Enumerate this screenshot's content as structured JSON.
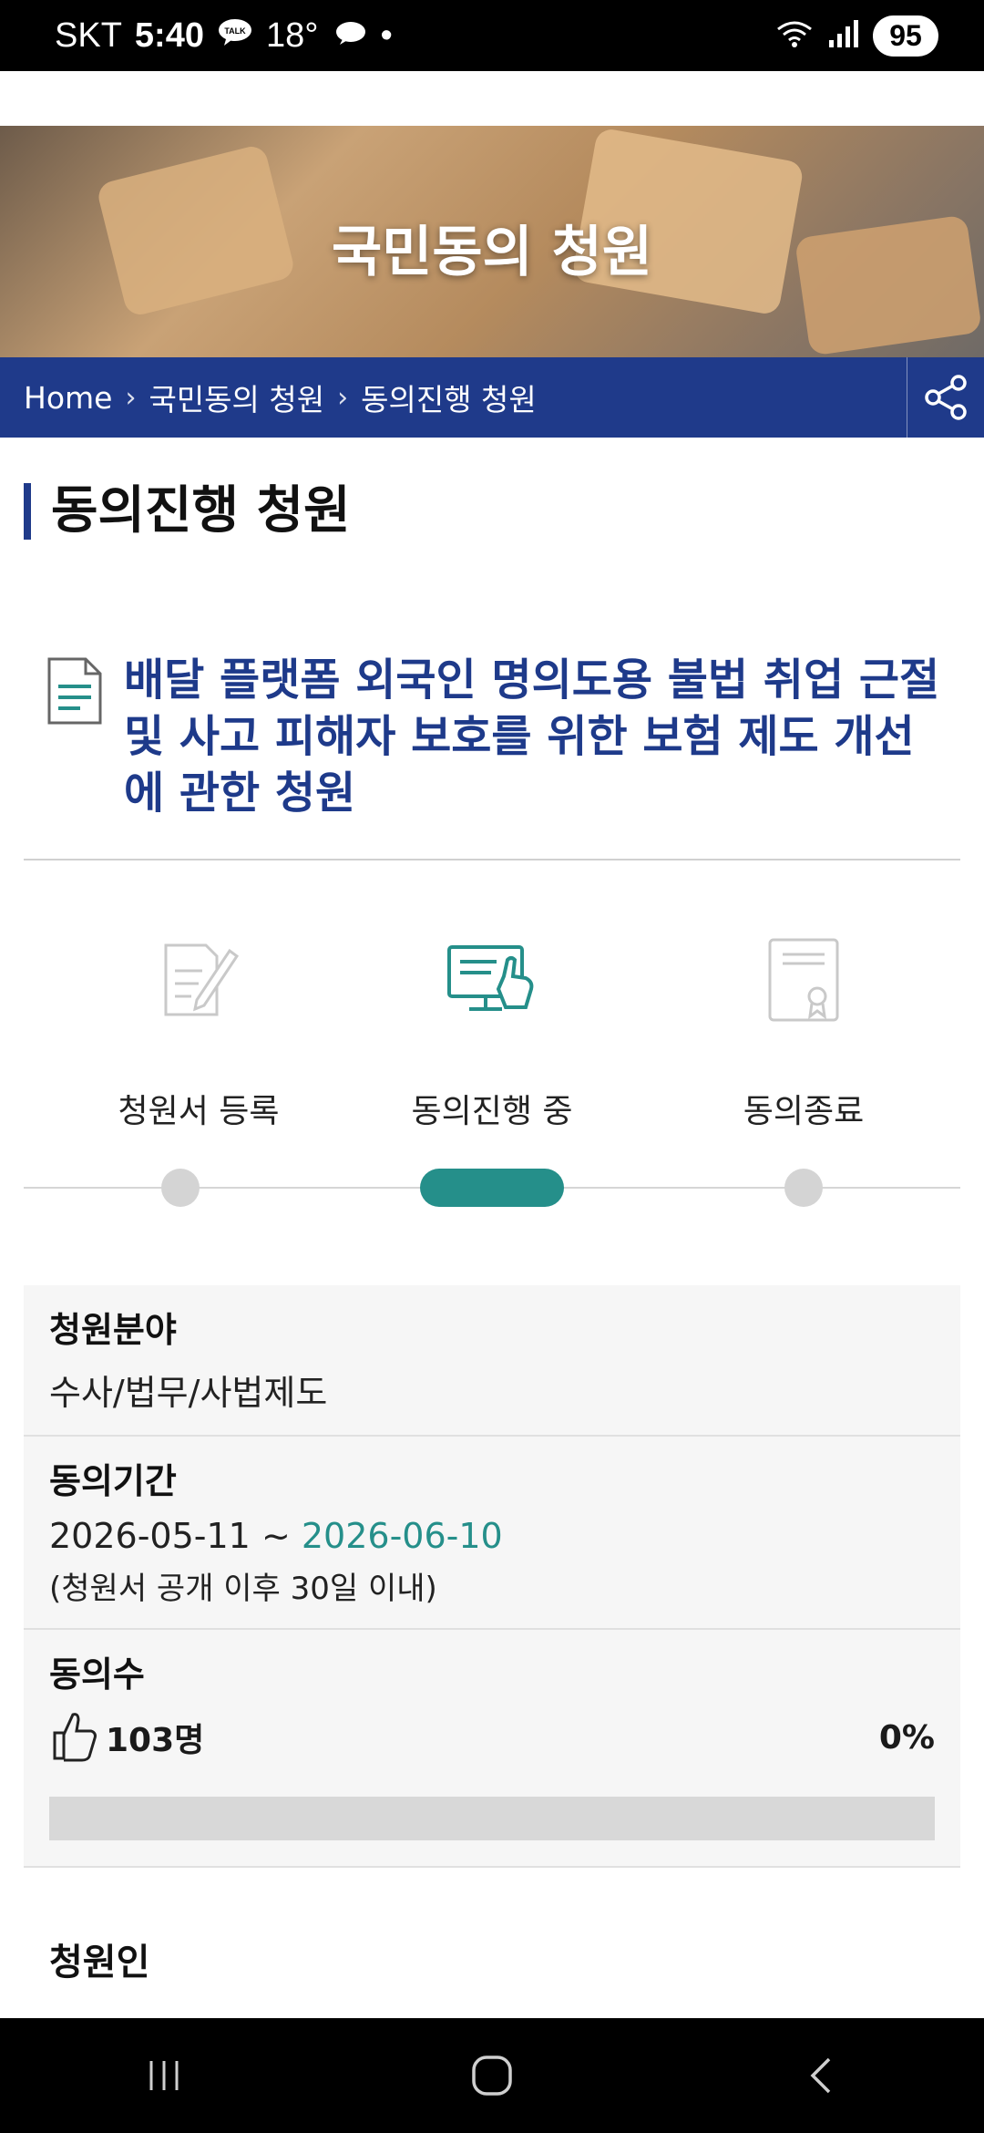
{
  "status_bar": {
    "carrier": "SKT",
    "time": "5:40",
    "temperature": "18°",
    "battery": "95",
    "icons": [
      "talk-icon",
      "weather-icon",
      "wifi-icon",
      "signal-icon"
    ]
  },
  "hero": {
    "title": "국민동의 청원"
  },
  "breadcrumb": {
    "items": [
      "Home",
      "국민동의 청원",
      "동의진행 청원"
    ],
    "separator": "›",
    "share_icon": "share-icon"
  },
  "section": {
    "title": "동의진행 청원"
  },
  "petition": {
    "icon": "document-icon",
    "title": "배달 플랫폼 외국인 명의도용 불법 취업 근절 및 사고 피해자 보호를 위한 보험 제도 개선에 관한 청원"
  },
  "steps": {
    "items": [
      {
        "label": "청원서 등록",
        "icon": "edit-document-icon",
        "active": false
      },
      {
        "label": "동의진행 중",
        "icon": "monitor-click-icon",
        "active": true
      },
      {
        "label": "동의종료",
        "icon": "certificate-icon",
        "active": false
      }
    ]
  },
  "info": {
    "field_label": "청원분야",
    "field_value": "수사/법무/사법제도",
    "period_label": "동의기간",
    "period_start": "2026-05-11",
    "period_tilde": "~",
    "period_end": "2026-06-10",
    "period_note": "(청원서 공개 이후 30일 이내)",
    "count_label": "동의수",
    "count_value": "103명",
    "percent": "0%",
    "progress": 0
  },
  "petitioner_label": "청원인",
  "colors": {
    "primary_navy": "#1f3a8a",
    "accent_teal": "#258f8a"
  }
}
